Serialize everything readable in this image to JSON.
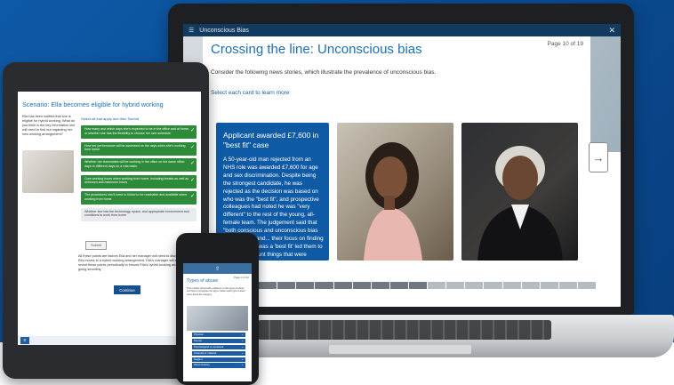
{
  "colors": {
    "brand_blue": "#0f5aa5",
    "check_green": "#2e8b3a",
    "title_blue": "#1f6fae"
  },
  "laptop": {
    "app_title": "Unconscious Bias",
    "close_icon": "close-icon",
    "page_title": "Crossing the line: Unconscious bias",
    "page_counter": "Page 10 of 19",
    "intro": "Consider the following news stories, which illustrate the prevalence of unconscious bias.",
    "select_prompt": "Select each card to learn more",
    "card": {
      "title": "Applicant awarded £7,600 in \"best fit\" case",
      "body": "A 50-year-old man rejected from an NHS role was awarded £7,600 for age and sex discrimination. Despite being the strongest candidate, he was rejected as the decision was based on who was the \"best fit\", and prospective colleagues had noted he was \"very different\" to the rest of the young, all-female team. The judgement said that \"both conscious and unconscious bias were at play, and... their focus on finding a person who was a 'best fit' led them to take into account things that were discriminatory.\""
    },
    "progress": {
      "total": 19,
      "current": 10
    }
  },
  "tablet": {
    "title": "Scenario: Ella becomes eligible for hybrid working",
    "left_text": "Ella has been notified that she is eligible for hybrid working. What do you think is the key information she will need to find out regarding her new working arrangement?",
    "instruction": "Select all that apply and then Submit",
    "options": [
      {
        "label": "How many and which days she's expected to be in the office and at home, or whether she has the flexibility to choose her own schedule",
        "selected": true
      },
      {
        "label": "How her performance will be assessed on the days when she's working from home",
        "selected": true
      },
      {
        "label": "Whether her teammates will be working in the office on the same office days or different days on a rota basis",
        "selected": true
      },
      {
        "label": "Core working hours when working from home, including breaks as well as minimum and maximum hours",
        "selected": true
      },
      {
        "label": "The procedures she'll need to follow to be reachable and available when working from home",
        "selected": true
      },
      {
        "label": "Whether she has the technology, space, and appropriate environment and conditions to work from home",
        "selected": false
      }
    ],
    "submit_label": "Submit",
    "note": "All these points are factors Ella and her manager will need to discuss before Ella moves to a hybrid working arrangement. Ella's manager will also need to revisit these points periodically to ensure Ella's hybrid working arrangement is going smoothly.",
    "continue_label": "Continue"
  },
  "phone": {
    "page_counter": "Page 3 of 22",
    "title": "Types of abuse",
    "intro": "This module will provide guidance on the types of abuse and how to recognise the signs. Select each type to learn more about the category.",
    "items": [
      "Physical",
      "Sexual",
      "Psychological or emotional",
      "Financial or material",
      "Neglect",
      "Discriminatory"
    ]
  }
}
